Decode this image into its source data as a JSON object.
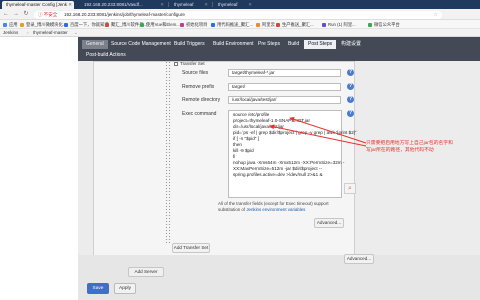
{
  "browser": {
    "tabs": [
      {
        "title": "thymeleaf-master Config [Jenk"
      },
      {
        "title": "192.168.20.233:8081/Vasdf..."
      },
      {
        "title": "thymeleaf"
      },
      {
        "title": "thymeleaf"
      }
    ],
    "back_icon": "back-arrow-icon",
    "forward_icon": "forward-arrow-icon",
    "reload_icon": "reload-icon",
    "security_label": "不安全",
    "url": "192.168.20.233:8081/jenkins/job/thymeleaf-master/configure",
    "star_icon": "star-icon"
  },
  "bookmarks": [
    {
      "label": "应用",
      "color": "#4285f4"
    },
    {
      "label": "登录_博川微模块化...",
      "color": "#e0a030"
    },
    {
      "label": "百度一下，你就知道",
      "color": "#2b6de8"
    },
    {
      "label": "聚汇_博川软件开...",
      "color": "#d04a3a"
    },
    {
      "label": "使用Vue和Elem...",
      "color": "#3aa757"
    },
    {
      "label": "初始化项目",
      "color": "#c04090"
    },
    {
      "label": "用代码推送_聚汇...",
      "color": "#2b6de8"
    },
    {
      "label": "阿里云",
      "color": "#f08a24"
    },
    {
      "label": "生产推送_聚汇...",
      "color": "#d04a3a"
    },
    {
      "label": "Run (1) 阿里...",
      "color": "#6a4ad0"
    },
    {
      "label": "微信公众平台",
      "color": "#3aa757"
    }
  ],
  "crumbs": {
    "jenkins": "Jenkins",
    "sep": "›",
    "job": "thymeleaf-master",
    "dropdown_icon": "chevron-down-icon"
  },
  "config_tabs": {
    "general": "General",
    "scm": "Source Code Management",
    "triggers": "Build Triggers",
    "environment": "Build Environment",
    "pre_steps": "Pre Steps",
    "build": "Build",
    "post_steps": "Post Steps",
    "build_settings": "构建设置",
    "post_build": "Post-build Actions"
  },
  "transfer": {
    "checkbox_label": "Transfer Set",
    "source_files_label": "Source files",
    "source_files_value": "target/thymeleaf-*.jar",
    "remove_prefix_label": "Remove prefix",
    "remove_prefix_value": "target/",
    "remote_directory_label": "Remote directory",
    "remote_directory_value": "/usr/local/java/test/jar/",
    "exec_command_label": "Exec command",
    "exec_command_lines": [
      "source /etc/profile",
      "project=thymeleaf-1.0-SNAPSHOT.jar",
      "dir=/usr/local/java/test/jar",
      "pid=`ps -ef | grep $dir/$project | grep -v grep | awk '{print $2}'`",
      "if [ -n \"$pid\" ]",
      "then",
      "  kill -9 $pid",
      "fi",
      "nohup java -Xms64m -Xmx512m -XX:PermSize=32m -",
      "XX:MaxPermSize=512m -jar $dir/$project --",
      "spring.profiles.active=dev >/dev/null 2>&1 &"
    ],
    "note_line1": "All of the transfer fields (except for Exec timeout) support",
    "note_line2_prefix": "substitution of ",
    "note_link": "Jenkins environment variables",
    "advanced": "Advanced...",
    "add_transfer_set": "Add Transfer Set",
    "add_server": "Add Server",
    "advanced_bottom": "Advanced...",
    "help_icon": "help-icon",
    "search_icon": "search-icon"
  },
  "annotation": {
    "line1": "只需要把启用地方写上自己jar包的名字和",
    "line2": "写jar所在的路径，其他代码不动",
    "color": "#e8312b"
  },
  "actions": {
    "save": "Save",
    "apply": "Apply"
  }
}
